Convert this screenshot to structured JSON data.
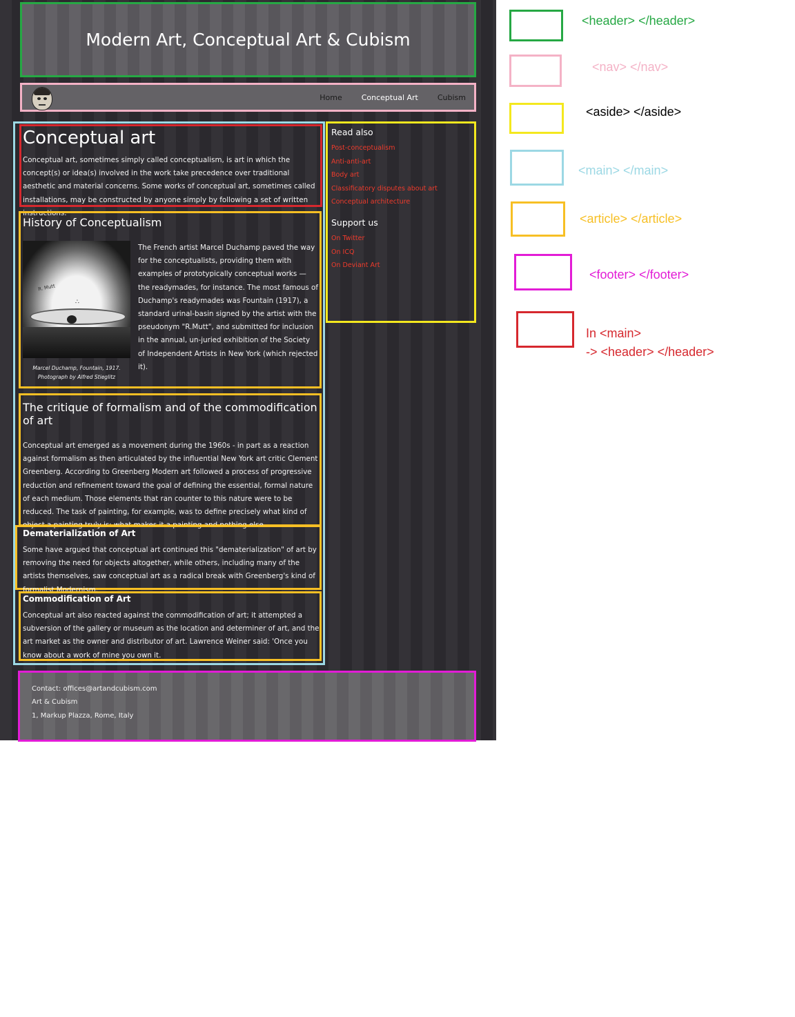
{
  "header": {
    "title": "Modern Art, Conceptual Art & Cubism"
  },
  "nav": {
    "links": [
      "Home",
      "Conceptual Art",
      "Cubism"
    ],
    "active": "Conceptual Art"
  },
  "main_header": {
    "title": "Conceptual art",
    "text": "Conceptual art, sometimes simply called conceptualism, is art in which the concept(s) or idea(s) involved in the work take precedence over traditional aesthetic and material concerns. Some works of conceptual art, sometimes called installations, may be constructed by anyone simply by following a set of written instructions."
  },
  "articles": [
    {
      "title": "History of Conceptualism",
      "image_caption": "Marcel Duchamp, Fountain, 1917. Photograph by Alfred Stieglitz",
      "text": "The French artist Marcel Duchamp paved the way for the conceptualists, providing them with examples of prototypically conceptual works — the readymades, for instance. The most famous of Duchamp's readymades was Fountain (1917), a standard urinal-basin signed by the artist with the pseudonym \"R.Mutt\", and submitted for inclusion in the annual, un-juried exhibition of the Society of Independent Artists in New York (which rejected it)."
    },
    {
      "title": "The critique of formalism and of the commodification of art",
      "text": "Conceptual art emerged as a movement during the 1960s - in part as a reaction against formalism as then articulated by the influential New York art critic Clement Greenberg. According to Greenberg Modern art followed a process of progressive reduction and refinement toward the goal of defining the essential, formal nature of each medium. Those elements that ran counter to this nature were to be reduced. The task of painting, for example, was to define precisely what kind of object a painting truly is: what makes it a painting and nothing else."
    },
    {
      "title": "Dematerialization of Art",
      "text": "Some have argued that conceptual art continued this \"dematerialization\" of art by removing the need for objects altogether, while others, including many of the artists themselves, saw conceptual art as a radical break with Greenberg's kind of formalist Modernism."
    },
    {
      "title": "Commodification of Art",
      "text": "Conceptual art also reacted against the commodification of art; it attempted a subversion of the gallery or museum as the location and determiner of art, and the art market as the owner and distributor of art. Lawrence Weiner said: 'Once you know about a work of mine you own it."
    }
  ],
  "aside": {
    "read_also_title": "Read also",
    "read_also_links": [
      "Post-conceptualism",
      "Anti-anti-art",
      "Body art",
      "Classificatory disputes about art",
      "Conceptual architecture"
    ],
    "support_title": "Support us",
    "support_links": [
      "On Twitter",
      "On ICQ",
      "On Deviant Art"
    ]
  },
  "footer": {
    "lines": [
      "Contact: offices@artandcubism.com",
      "Art & Cubism",
      "1, Markup Plazza, Rome, Italy"
    ]
  },
  "legend": [
    {
      "label": "<header> </header>",
      "color": "#26a844"
    },
    {
      "label": "<nav> </nav>",
      "color": "#f4b2c6"
    },
    {
      "label": "<aside> </aside>",
      "color": "#f4e81e"
    },
    {
      "label": "<main> </main>",
      "color": "#9cd8e4"
    },
    {
      "label": "<article> </article>",
      "color": "#f7bf24"
    },
    {
      "label": "<footer> </footer>",
      "color": "#e21cd6"
    },
    {
      "label": "In <main>",
      "label2": "-> <header> </header>",
      "color": "#d6282e"
    }
  ],
  "colors": {
    "page_bg": "#2d2b30",
    "link": "#ee3b2c"
  }
}
